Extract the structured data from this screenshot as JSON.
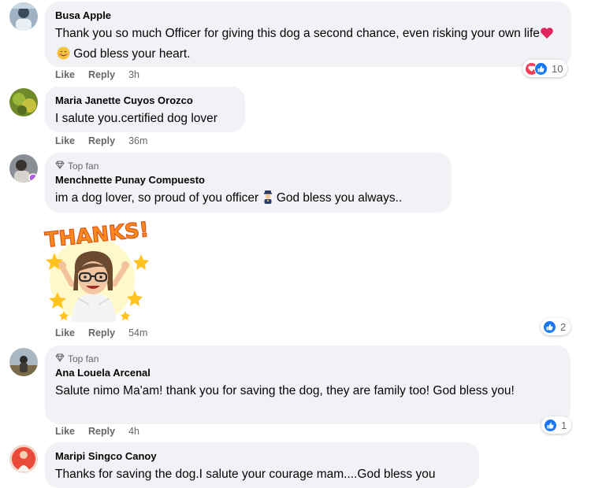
{
  "comments": [
    {
      "author": "Busa Apple",
      "text_before": "Thank you so much Officer for giving this dog a second chance, even risking your own life",
      "text_after": " God bless your heart.",
      "like_label": "Like",
      "reply_label": "Reply",
      "time": "3h",
      "reaction_count": "10",
      "reaction_icons": [
        "love-icon",
        "like-icon"
      ]
    },
    {
      "author": "Maria Janette Cuyos Orozco",
      "text": "I salute you.certified dog lover",
      "like_label": "Like",
      "reply_label": "Reply",
      "time": "36m"
    },
    {
      "badge": "Top fan",
      "author": "Menchnette Punay Compuesto",
      "text_before": "im a dog lover, so proud of you officer",
      "text_after": " God bless you always..",
      "sticker_text": "THANKS!",
      "like_label": "Like",
      "reply_label": "Reply",
      "time": "54m",
      "reaction_count": "2",
      "reaction_icons": [
        "like-icon"
      ]
    },
    {
      "badge": "Top fan",
      "author": "Ana Louela Arcenal",
      "text": "Salute nimo Ma'am! thank you for saving the dog, they are family too! God bless you!",
      "like_label": "Like",
      "reply_label": "Reply",
      "time": "4h",
      "reaction_count": "1",
      "reaction_icons": [
        "like-icon"
      ]
    },
    {
      "author": "Maripi Singco Canoy",
      "text": "Thanks for saving the dog.I salute your courage mam....God bless you"
    }
  ],
  "colors": {
    "bubble": "#f0f2f5",
    "like_blue": "#1877f2",
    "love_red": "#f33e58",
    "muted": "#65676b"
  }
}
